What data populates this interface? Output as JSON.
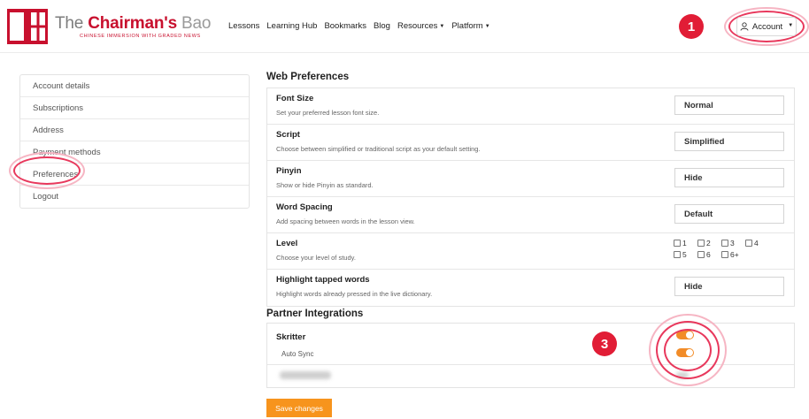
{
  "brand": {
    "name_the": "The ",
    "name_chairmans": "Chairman's",
    "name_bao": " Bao",
    "tagline": "CHINESE IMMERSION WITH GRADED NEWS",
    "accent": "#c8102e"
  },
  "nav": {
    "items": [
      {
        "label": "Lessons",
        "dropdown": false
      },
      {
        "label": "Learning Hub",
        "dropdown": false
      },
      {
        "label": "Bookmarks",
        "dropdown": false
      },
      {
        "label": "Blog",
        "dropdown": false
      },
      {
        "label": "Resources",
        "dropdown": true
      },
      {
        "label": "Platform",
        "dropdown": true
      }
    ],
    "account_label": "Account"
  },
  "annotations": {
    "step1": "1",
    "step3": "3"
  },
  "sidebar": {
    "items": [
      "Account details",
      "Subscriptions",
      "Address",
      "Payment methods",
      "Preferences",
      "Logout"
    ]
  },
  "web_preferences": {
    "title": "Web Preferences",
    "rows": [
      {
        "name": "Font Size",
        "desc": "Set your preferred lesson font size.",
        "value": "Normal"
      },
      {
        "name": "Script",
        "desc": "Choose between simplified or traditional script as your default setting.",
        "value": "Simplified"
      },
      {
        "name": "Pinyin",
        "desc": "Show or hide Pinyin as standard.",
        "value": "Hide"
      },
      {
        "name": "Word Spacing",
        "desc": "Add spacing between words in the lesson view.",
        "value": "Default"
      },
      {
        "name": "Level",
        "desc": "Choose your level of study.",
        "levels": [
          "1",
          "2",
          "3",
          "4",
          "5",
          "6",
          "6+"
        ]
      },
      {
        "name": "Highlight tapped words",
        "desc": "Highlight words already pressed in the live dictionary.",
        "value": "Hide"
      }
    ]
  },
  "partner_integrations": {
    "title": "Partner Integrations",
    "skritter": {
      "name": "Skritter",
      "sub": "Auto Sync",
      "enabled": true,
      "auto_sync": true
    }
  },
  "save_label": "Save changes",
  "colors": {
    "toggle_on": "#f28c28",
    "save_button": "#f7941d",
    "annotation": "#e11d36"
  }
}
